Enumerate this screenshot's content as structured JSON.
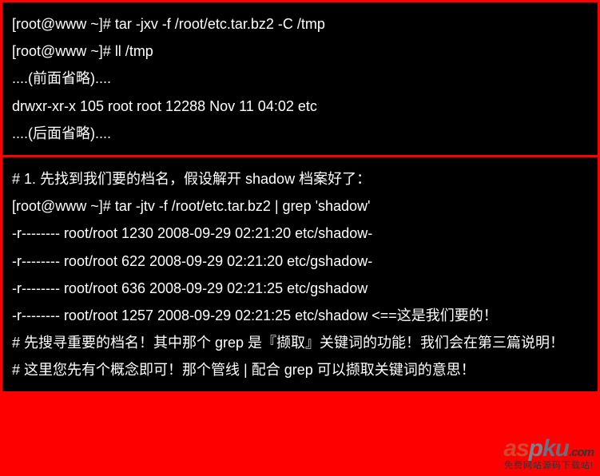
{
  "panel1": {
    "l1": "[root@www ~]# tar -jxv -f /root/etc.tar.bz2 -C /tmp",
    "l2": "[root@www ~]# ll /tmp",
    "l3": "....(前面省略)....",
    "l4": "drwxr-xr-x 105 root root    12288 Nov 11 04:02 etc",
    "l5": "....(后面省略)...."
  },
  "panel2": {
    "c1": "# 1. 先找到我们要的档名，假设解开 shadow 档案好了：",
    "cmd": "[root@www ~]# tar -jtv -f /root/etc.tar.bz2 | grep 'shadow'",
    "r1": "-r-------- root/root  1230 2008-09-29 02:21:20 etc/shadow-",
    "r2": "-r-------- root/root   622 2008-09-29 02:21:20 etc/gshadow-",
    "r3": "-r-------- root/root   636 2008-09-29 02:21:25 etc/gshadow",
    "r4": "-r-------- root/root  1257 2008-09-29 02:21:25 etc/shadow  <==这是我们要的！",
    "c2": "# 先搜寻重要的档名！其中那个 grep 是『撷取』关键词的功能！我们会在第三篇说明！",
    "c3": "# 这里您先有个概念即可！那个管线 | 配合 grep 可以撷取关键词的意思！"
  },
  "watermark": {
    "a": "a",
    "s": "s",
    "p": "p",
    "k": "k",
    "u": "u",
    "com": ".com",
    "sub": "免费网站源码下载站!"
  }
}
